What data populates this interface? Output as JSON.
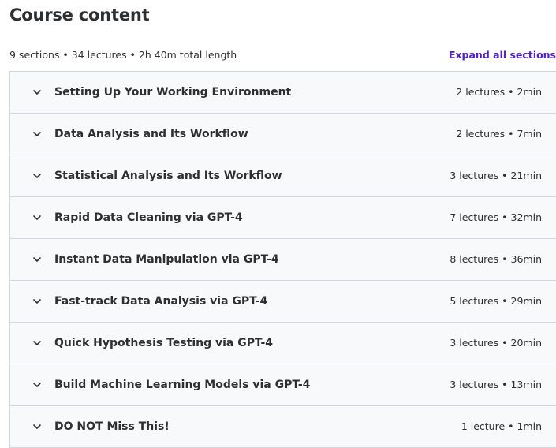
{
  "header": {
    "title": "Course content",
    "summary": "9 sections • 34 lectures • 2h 40m total length",
    "expand_label": "Expand all sections"
  },
  "sections": [
    {
      "title": "Setting Up Your Working Environment",
      "meta": "2 lectures • 2min"
    },
    {
      "title": "Data Analysis and Its Workflow",
      "meta": "2 lectures • 7min"
    },
    {
      "title": "Statistical Analysis and Its Workflow",
      "meta": "3 lectures • 21min"
    },
    {
      "title": "Rapid Data Cleaning via GPT-4",
      "meta": "7 lectures • 32min"
    },
    {
      "title": "Instant Data Manipulation via GPT-4",
      "meta": "8 lectures • 36min"
    },
    {
      "title": "Fast-track Data Analysis via GPT-4",
      "meta": "5 lectures • 29min"
    },
    {
      "title": "Quick Hypothesis Testing via GPT-4",
      "meta": "3 lectures • 20min"
    },
    {
      "title": "Build Machine Learning Models via GPT-4",
      "meta": "3 lectures • 13min"
    },
    {
      "title": "DO NOT Miss This!",
      "meta": "1 lecture • 1min"
    }
  ],
  "icons": {
    "chevron": "chevron-down-icon"
  },
  "colors": {
    "accent": "#5022c3",
    "row_bg": "#f7f9fa",
    "border": "#d1d7dc",
    "text": "#2d2f31"
  }
}
